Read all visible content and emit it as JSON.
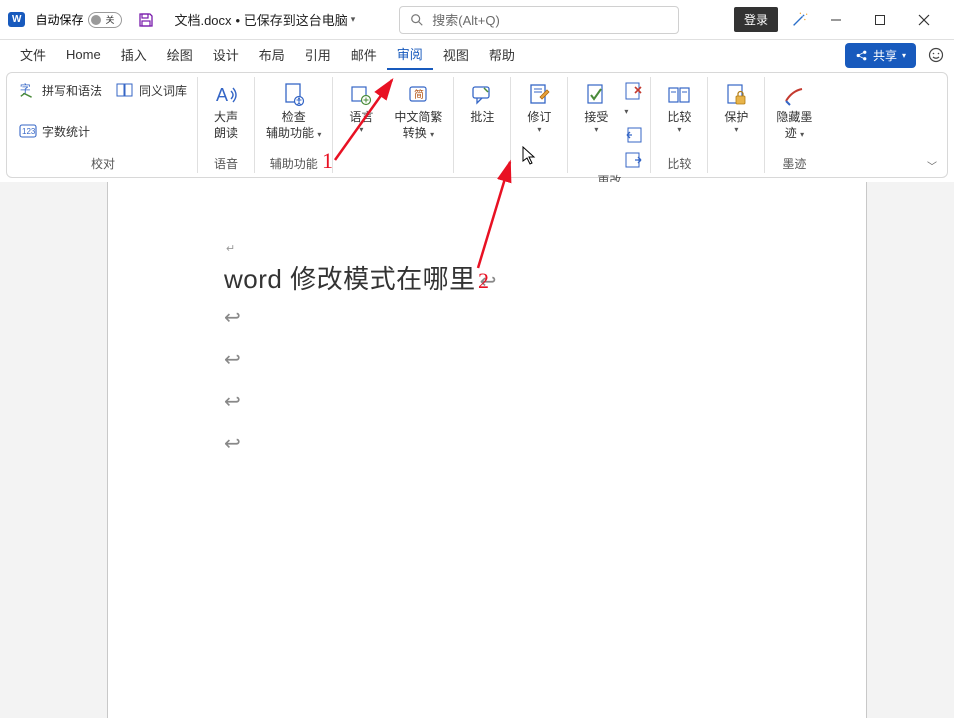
{
  "titlebar": {
    "autosave_label": "自动保存",
    "autosave_off": "关",
    "doc_name": "文档.docx",
    "doc_status": "• 已保存到这台电脑",
    "search_placeholder": "搜索(Alt+Q)",
    "login_label": "登录"
  },
  "tabs": {
    "items": [
      {
        "label": "文件"
      },
      {
        "label": "Home"
      },
      {
        "label": "插入"
      },
      {
        "label": "绘图"
      },
      {
        "label": "设计"
      },
      {
        "label": "布局"
      },
      {
        "label": "引用"
      },
      {
        "label": "邮件"
      },
      {
        "label": "审阅"
      },
      {
        "label": "视图"
      },
      {
        "label": "帮助"
      }
    ],
    "active_index": 8,
    "share_label": "共享"
  },
  "ribbon": {
    "groups": [
      {
        "label": "校对",
        "small_items": [
          {
            "label": "拼写和语法",
            "icon": "spellcheck-icon"
          },
          {
            "label": "同义词库",
            "icon": "thesaurus-icon"
          },
          {
            "label": "字数统计",
            "icon": "wordcount-icon"
          }
        ]
      },
      {
        "label": "语音",
        "big_items": [
          {
            "label": "大声朗读",
            "icon": "readaloud-icon"
          }
        ]
      },
      {
        "label": "辅助功能",
        "big_items": [
          {
            "label": "检查辅助功能",
            "icon": "accessibility-icon",
            "caret": true
          }
        ]
      },
      {
        "label": "",
        "big_items": [
          {
            "label": "语言",
            "icon": "language-icon",
            "caret": true
          },
          {
            "label": "中文简繁转换",
            "icon": "translate-icon",
            "caret": true
          }
        ]
      },
      {
        "label": "",
        "big_items": [
          {
            "label": "批注",
            "icon": "comment-icon"
          }
        ]
      },
      {
        "label": "",
        "big_items": [
          {
            "label": "修订",
            "icon": "track-icon",
            "caret": true
          }
        ]
      },
      {
        "label": "更改",
        "big_items": [
          {
            "label": "接受",
            "icon": "accept-icon",
            "caret": true
          }
        ],
        "mini_icons": [
          "reject-icon",
          "prev-icon",
          "next-icon"
        ]
      },
      {
        "label": "比较",
        "big_items": [
          {
            "label": "比较",
            "icon": "compare-icon",
            "caret": true
          }
        ]
      },
      {
        "label": "",
        "big_items": [
          {
            "label": "保护",
            "icon": "protect-icon",
            "caret": true
          }
        ]
      },
      {
        "label": "墨迹",
        "big_items": [
          {
            "label": "隐藏墨迹",
            "icon": "ink-icon",
            "caret": true
          }
        ]
      }
    ]
  },
  "document": {
    "heading_text": "word 修改模式在哪里"
  },
  "annotations": {
    "num1": "1",
    "num2": "2"
  }
}
